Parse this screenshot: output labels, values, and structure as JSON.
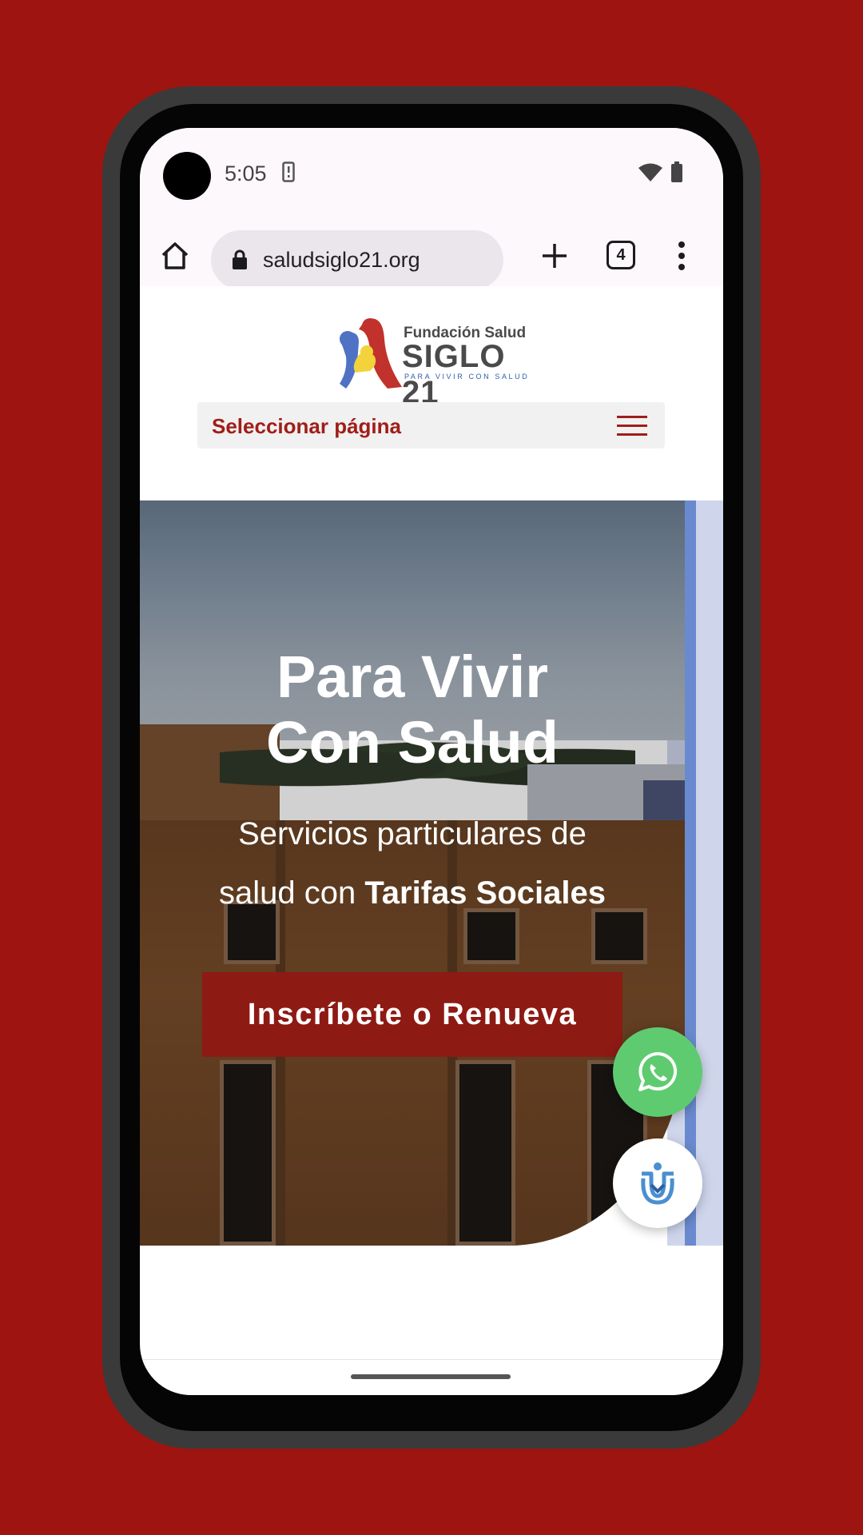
{
  "status_bar": {
    "time": "5:05"
  },
  "browser": {
    "url": "saludsiglo21.org",
    "tab_count": "4"
  },
  "site": {
    "logo": {
      "line1": "Fundación Salud",
      "line2": "SIGLO 21",
      "line3": "PARA VIVIR CON SALUD"
    },
    "nav_select_label": "Seleccionar página"
  },
  "hero": {
    "title_line1": "Para Vivir",
    "title_line2": "Con Salud",
    "subtitle_line1": "Servicios particulares de",
    "subtitle_line2_prefix": "salud con ",
    "subtitle_line2_bold": "Tarifas Sociales",
    "cta_label": "Inscríbete o Renueva"
  },
  "colors": {
    "background": "#9e1410",
    "brand_red": "#a01e19",
    "cta_red": "#8e1a14",
    "whatsapp_green": "#5fcb70",
    "accent_blue": "#6a8acf"
  },
  "icons": {
    "home": "home-icon",
    "lock": "lock-icon",
    "new_tab": "plus-icon",
    "menu": "overflow-menu-icon",
    "hamburger": "hamburger-icon",
    "whatsapp": "whatsapp-icon",
    "accessibility": "accessibility-icon"
  }
}
